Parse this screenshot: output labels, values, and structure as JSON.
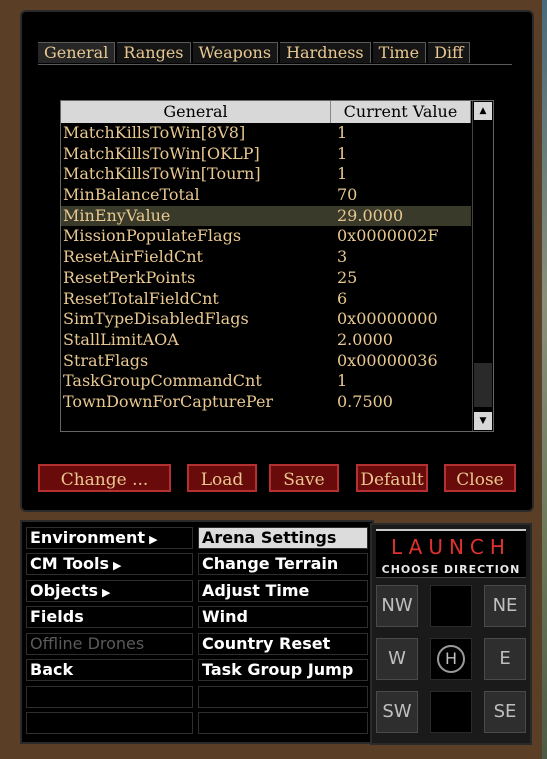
{
  "tabs": [
    "General",
    "Ranges",
    "Weapons",
    "Hardness",
    "Time",
    "Diff"
  ],
  "table": {
    "headers": [
      "General",
      "Current Value"
    ],
    "rows": [
      {
        "key": "MatchKillsToWin[8V8]",
        "value": "1"
      },
      {
        "key": "MatchKillsToWin[OKLP]",
        "value": "1"
      },
      {
        "key": "MatchKillsToWin[Tourn]",
        "value": "1"
      },
      {
        "key": "MinBalanceTotal",
        "value": "70"
      },
      {
        "key": "MinEnyValue",
        "value": "29.0000"
      },
      {
        "key": "MissionPopulateFlags",
        "value": "0x0000002F"
      },
      {
        "key": "ResetAirFieldCnt",
        "value": "3"
      },
      {
        "key": "ResetPerkPoints",
        "value": "25"
      },
      {
        "key": "ResetTotalFieldCnt",
        "value": "6"
      },
      {
        "key": "SimTypeDisabledFlags",
        "value": "0x00000000"
      },
      {
        "key": "StallLimitAOA",
        "value": "2.0000"
      },
      {
        "key": "StratFlags",
        "value": "0x00000036"
      },
      {
        "key": "TaskGroupCommandCnt",
        "value": "1"
      },
      {
        "key": "TownDownForCapturePer",
        "value": "0.7500"
      }
    ]
  },
  "buttons": {
    "change": "Change ...",
    "load": "Load",
    "save": "Save",
    "default": "Default",
    "close": "Close"
  },
  "menu": {
    "left": [
      "Environment",
      "CM Tools",
      "Objects",
      "Fields",
      "Offline Drones",
      "Back"
    ],
    "right": [
      "Arena Settings",
      "Change Terrain",
      "Adjust Time",
      "Wind",
      "Country Reset",
      "Task Group Jump"
    ]
  },
  "launch": {
    "title": "LAUNCH",
    "subtitle": "CHOOSE DIRECTION",
    "nw": "NW",
    "ne": "NE",
    "w": "W",
    "e": "E",
    "sw": "SW",
    "se": "SE",
    "center": "H"
  },
  "colors": {
    "text_gold": "#e8c890",
    "button_red": "#6a0b0b",
    "launch_red": "#e03030"
  }
}
